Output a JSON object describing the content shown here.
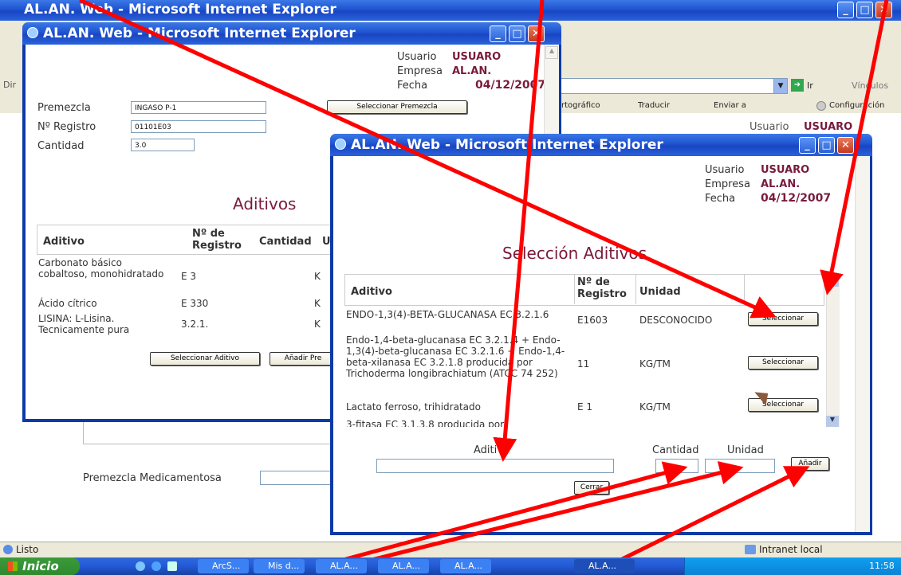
{
  "back_window": {
    "title": "AL.AN. Web - Microsoft Internet Explorer",
    "address_label": "Dir",
    "links_label": "Vínculos",
    "go_label": "Ir",
    "toolbar": {
      "ortografico": "rtográfico",
      "traducir": "Traducir",
      "enviar": "Enviar a",
      "configuracion": "Configuración"
    },
    "status": {
      "left": "Listo",
      "right": "Intranet local"
    },
    "premezcla_medicamentosa": "Premezcla Medicamentosa",
    "usuario_label": "Usuario",
    "usuario_value": "USUARO"
  },
  "window1": {
    "title": "AL.AN. Web - Microsoft Internet Explorer",
    "usuario_label": "Usuario",
    "usuario_value": "USUARO",
    "empresa_label": "Empresa",
    "empresa_value": "AL.AN.",
    "fecha_label": "Fecha",
    "fecha_value": "04/12/2007",
    "premezcla_label": "Premezcla",
    "premezcla_value": "INGASO P-1",
    "registro_label": "Nº Registro",
    "registro_value": "01101E03",
    "cantidad_label": "Cantidad",
    "cantidad_value": "3.0",
    "seleccionar_premezcla": "Seleccionar Premezcla",
    "aditivos_heading": "Aditivos",
    "table_headers": {
      "aditivo": "Aditivo",
      "registro": "Nº de Registro",
      "cantidad": "Cantidad",
      "unidad": "U"
    },
    "rows": [
      {
        "aditivo": "Carbonato básico cobaltoso, monohidratado",
        "registro": "E 3",
        "unidad": "K"
      },
      {
        "aditivo": "Ácido cítrico",
        "registro": "E 330",
        "unidad": "K"
      },
      {
        "aditivo": "LISINA: L-Lisina. Tecnicamente pura",
        "registro": "3.2.1.",
        "unidad": "K"
      }
    ],
    "seleccionar_aditivo": "Seleccionar Aditivo",
    "anadir_pre": "Añadir Pre"
  },
  "window2": {
    "title": "AL.AN. Web - Microsoft Internet Explorer",
    "usuario_label": "Usuario",
    "usuario_value": "USUARO",
    "empresa_label": "Empresa",
    "empresa_value": "AL.AN.",
    "fecha_label": "Fecha",
    "fecha_value": "04/12/2007",
    "heading": "Selección Aditivos",
    "table_headers": {
      "aditivo": "Aditivo",
      "registro": "Nº de Registro",
      "unidad": "Unidad"
    },
    "rows": [
      {
        "aditivo": "ENDO-1,3(4)-BETA-GLUCANASA EC 3.2.1.6",
        "registro": "E1603",
        "unidad": "DESCONOCIDO",
        "button": "Seleccionar"
      },
      {
        "aditivo": "Endo-1,4-beta-glucanasa EC 3.2.1.4 + Endo-1,3(4)-beta-glucanasa EC 3.2.1.6 + Endo-1,4-beta-xilanasa EC 3.2.1.8 producida por Trichoderma longibrachiatum (ATCC 74 252)",
        "registro": "11",
        "unidad": "KG/TM",
        "button": "Seleccionar"
      },
      {
        "aditivo": "Lactato ferroso, trihidratado",
        "registro": "E 1",
        "unidad": "KG/TM",
        "button": "Seleccionar"
      },
      {
        "aditivo": "3-fitasa EC 3.1.3.8 producida por",
        "registro": "",
        "unidad": "",
        "button": ""
      }
    ],
    "aditivo_label": "Aditivo",
    "cantidad_label": "Cantidad",
    "unidad_label": "Unidad",
    "anadir_button": "Añadir",
    "cerrar_button": "Cerrar"
  },
  "taskbar": {
    "start": "Inicio",
    "items": [
      "ArcS...",
      "Mis d...",
      "AL.A...",
      "AL.A...",
      "AL.A...",
      "AL.A..."
    ],
    "clock": "11:58"
  },
  "colors": {
    "accent_arrow": "#ff0000",
    "maroon": "#7a1a3d",
    "xp_blue": "#1f54d0"
  }
}
